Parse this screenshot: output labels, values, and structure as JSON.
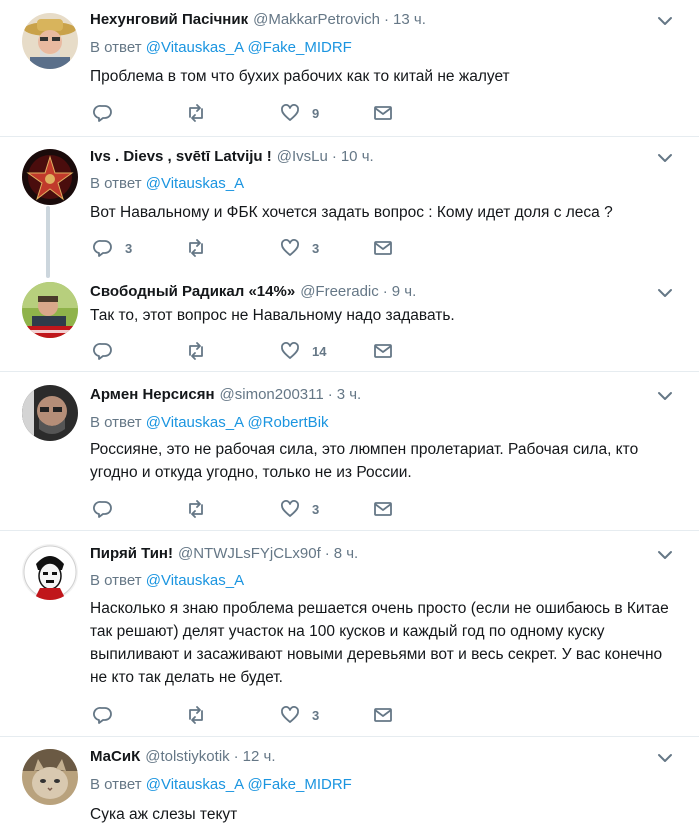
{
  "reply_prefix": "В ответ",
  "tweets": [
    {
      "name": "Нехунговий Пасічник",
      "handle": "@MakkarPetrovich",
      "dot": "·",
      "time": "13 ч.",
      "reply_to": [
        "@Vitauskas_A",
        "@Fake_MIDRF"
      ],
      "text": "Проблема в том что бухих рабочих как то китай не жалует",
      "reply_count": "",
      "retweet_count": "",
      "like_count": "9"
    },
    {
      "name": "Ivs . Dievs , svētī Latviju !",
      "handle": "@IvsLu",
      "dot": "·",
      "time": "10 ч.",
      "reply_to": [
        "@Vitauskas_A"
      ],
      "text": "Вот Навальному и ФБК хочется задать вопрос : Кому идет доля с леса ?",
      "reply_count": "3",
      "retweet_count": "",
      "like_count": "3"
    },
    {
      "name": "Свободный Радикал «14%»",
      "handle": "@Freeradic",
      "dot": "·",
      "time": "9 ч.",
      "reply_to": [],
      "text": "Так то, этот вопрос не Навальному надо задавать.",
      "reply_count": "",
      "retweet_count": "",
      "like_count": "14"
    },
    {
      "name": "Армен Нерсисян",
      "handle": "@simon200311",
      "dot": "·",
      "time": "3 ч.",
      "reply_to": [
        "@Vitauskas_A",
        "@RobertBik"
      ],
      "text": "Россияне, это не рабочая сила, это люмпен пролетариат. Рабочая сила, кто угодно и откуда угодно, только не из России.",
      "reply_count": "",
      "retweet_count": "",
      "like_count": "3"
    },
    {
      "name": "Пиряй Тин!",
      "handle": "@NTWJLsFYjCLx90f",
      "dot": "·",
      "time": "8 ч.",
      "reply_to": [
        "@Vitauskas_A"
      ],
      "text": "Насколько я знаю проблема решается очень просто (если не ошибаюсь в Китае так решают) делят участок на 100 кусков и каждый год по одному куску выпиливают и засаживают новыми деревьями вот и весь секрет. У вас конечно не кто так делать не будет.",
      "reply_count": "",
      "retweet_count": "",
      "like_count": "3"
    },
    {
      "name": "МаСиК",
      "handle": "@tolstiykotik",
      "dot": "·",
      "time": "12 ч.",
      "reply_to": [
        "@Vitauskas_A",
        "@Fake_MIDRF"
      ],
      "text": "Сука аж слезы текут",
      "reply_count": "",
      "retweet_count": "",
      "like_count": ""
    }
  ],
  "icons": {
    "reply": "reply-icon",
    "retweet": "retweet-icon",
    "like": "heart-icon",
    "dm": "envelope-icon",
    "menu": "chevron-down-icon"
  },
  "colors": {
    "text": "#14171a",
    "secondary": "#657786",
    "link": "#1b95e0",
    "separator": "#e6ecf0",
    "thread_line": "#ccd6dd"
  }
}
